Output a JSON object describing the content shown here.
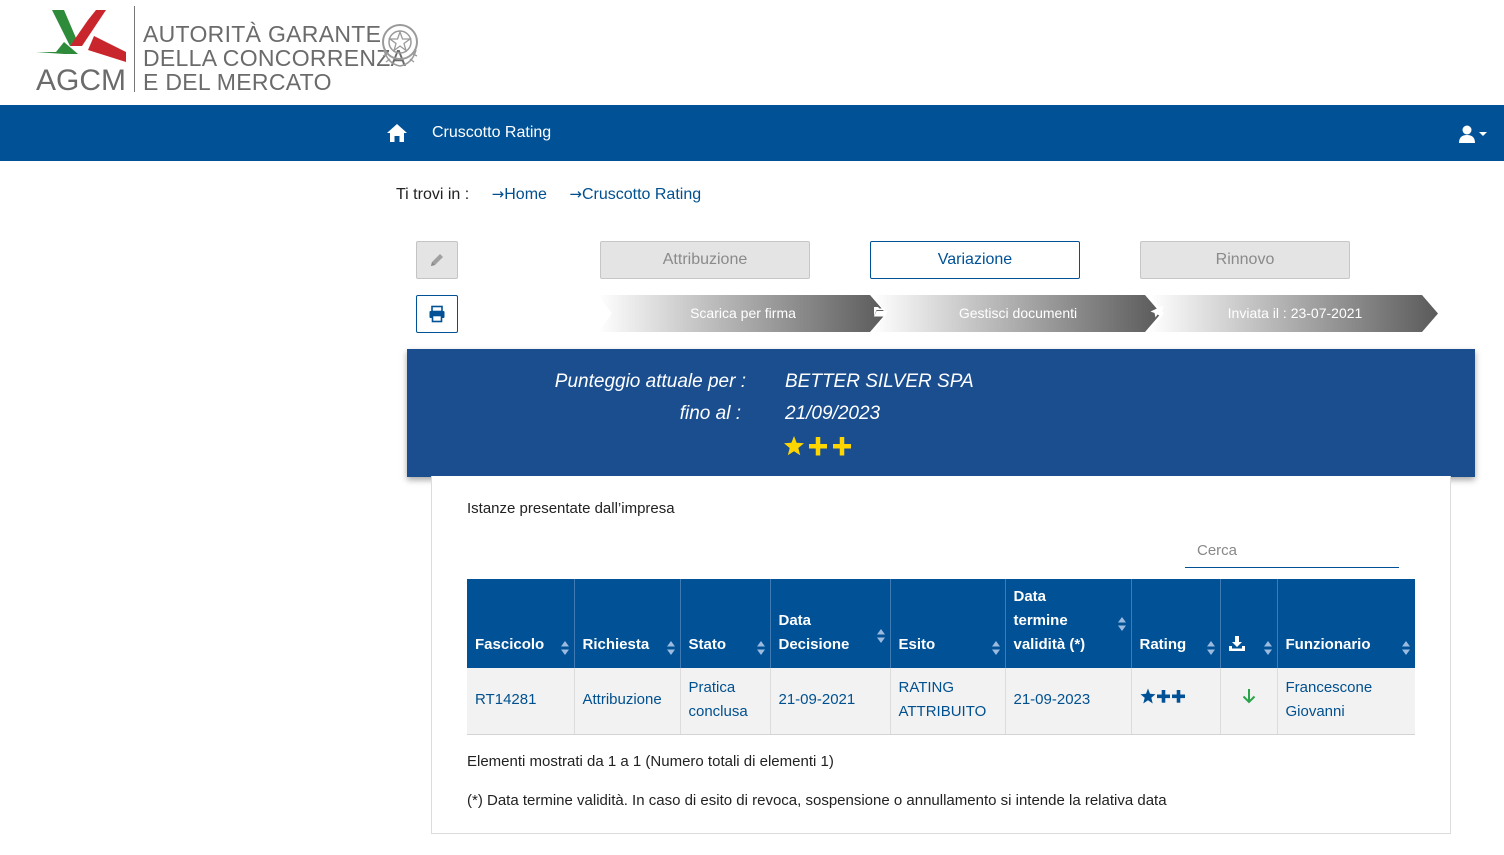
{
  "header": {
    "logo_acronym": "AGCM",
    "logo_lines": [
      "AUTORITÀ GARANTE",
      "DELLA CONCORRENZA",
      "E DEL MERCATO"
    ],
    "emblem_icon": "italian-republic-emblem-icon"
  },
  "navbar": {
    "home_icon": "home-icon",
    "title": "Cruscotto Rating",
    "user_icon": "user-icon",
    "color": "#005195"
  },
  "breadcrumb": {
    "prefix": "Ti trovi in :",
    "items": [
      "Home",
      "Cruscotto Rating"
    ]
  },
  "actions": {
    "edit_icon": "pencil-icon",
    "print_icon": "printer-icon",
    "tabs": [
      "Attribuzione",
      "Variazione",
      "Rinnovo"
    ]
  },
  "steps": [
    {
      "icon": "download-icon",
      "label": "Scarica per firma"
    },
    {
      "icon": "folder-open-icon",
      "label": "Gestisci documenti"
    },
    {
      "icon": "paper-plane-icon",
      "label": "Inviata il : 23-07-2021"
    }
  ],
  "score": {
    "label_company": "Punteggio attuale per :",
    "company": "BETTER SILVER SPA",
    "label_until": "fino al :",
    "until": "21/09/2023",
    "rating": {
      "stars": 1,
      "plus": 2
    }
  },
  "card": {
    "title": "Istanze presentate dall’impresa",
    "search_placeholder": "Cerca"
  },
  "table": {
    "headers": [
      "Fascicolo",
      "Richiesta",
      "Stato",
      "Data Decisione",
      "Esito",
      "Data termine validità (*)",
      "Rating",
      "",
      "Funzionario"
    ],
    "download_header_icon": "download-icon",
    "rows": [
      {
        "fascicolo": "RT14281",
        "richiesta": "Attribuzione",
        "stato": "Pratica conclusa",
        "data_decisione": "21-09-2021",
        "esito": "RATING ATTRIBUITO",
        "data_termine": "21-09-2023",
        "rating": {
          "stars": 1,
          "plus": 2
        },
        "download_icon": "arrow-down-icon",
        "funzionario": "Francescone Giovanni"
      }
    ]
  },
  "footer": {
    "count_text": "Elementi mostrati da 1 a 1 (Numero totali di elementi 1)",
    "note": "(*) Data termine validità. In caso di esito di revoca, sospensione o annullamento si intende la relativa data"
  }
}
